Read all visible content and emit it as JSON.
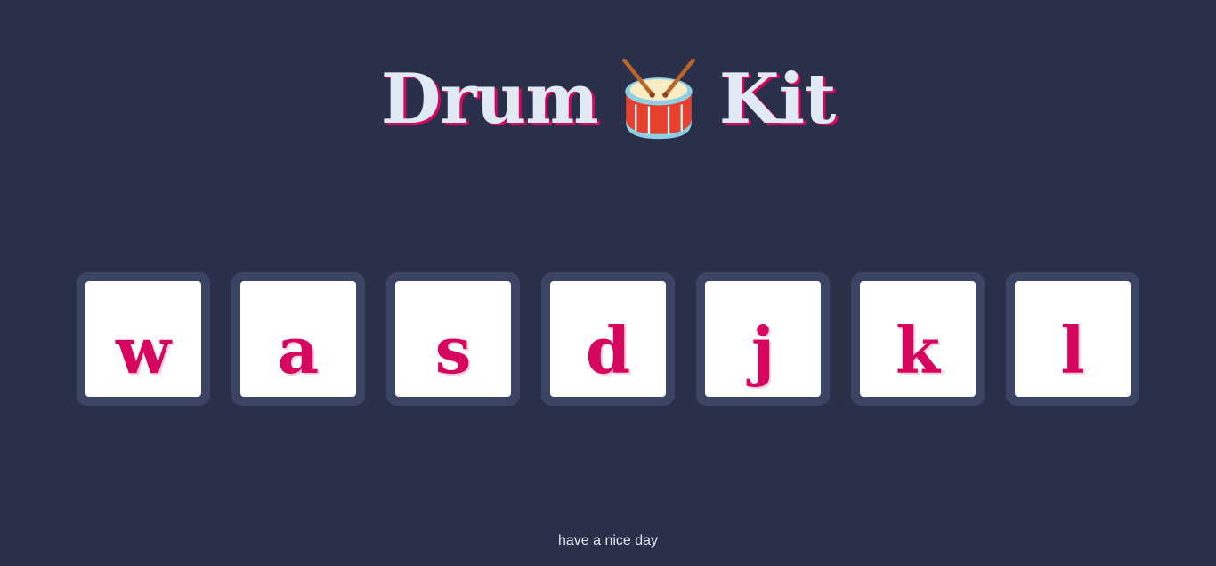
{
  "header": {
    "title_left": "Drum",
    "title_right": "Kit",
    "icon": "drum-icon"
  },
  "keys": [
    {
      "label": "w"
    },
    {
      "label": "a"
    },
    {
      "label": "s"
    },
    {
      "label": "d"
    },
    {
      "label": "j"
    },
    {
      "label": "k"
    },
    {
      "label": "l"
    }
  ],
  "footer": {
    "text": "have a nice day"
  },
  "colors": {
    "background": "#2a3049",
    "key_border": "#3b4563",
    "accent": "#d6065f",
    "title": "#dfeaf5"
  }
}
